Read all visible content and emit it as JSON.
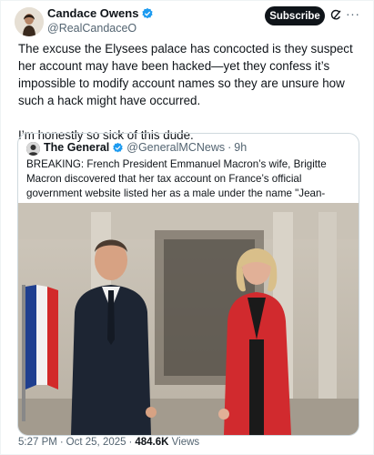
{
  "author": {
    "display_name": "Candace Owens",
    "handle": "@RealCandaceO",
    "verified_color": "#1d9bf0"
  },
  "actions": {
    "subscribe_label": "Subscribe",
    "grok_icon": "grok-icon",
    "more_label": "···"
  },
  "tweet": {
    "paragraph_1": "The excuse the Elysees palace has concocted is they suspect her account may have been hacked—yet they confess it’s impossible to modify account names so they are unsure how such a hack might have occurred.",
    "paragraph_2": "I’m honestly so sick of this dude."
  },
  "quoted": {
    "display_name": "The General",
    "handle": "@GeneralMCNews",
    "separator": "·",
    "time": "9h",
    "text": "BREAKING: French President Emmanuel Macron’s wife, Brigitte Macron discovered that her tax account on France’s official government website listed her as a male under the name \"Jean-Michel.\"",
    "image": "photo-of-couple-walking-outside-palace"
  },
  "footer": {
    "time": "5:27 PM",
    "dot": "·",
    "date": "Oct 25, 2025",
    "views_count": "484.6K",
    "views_label": "Views"
  }
}
